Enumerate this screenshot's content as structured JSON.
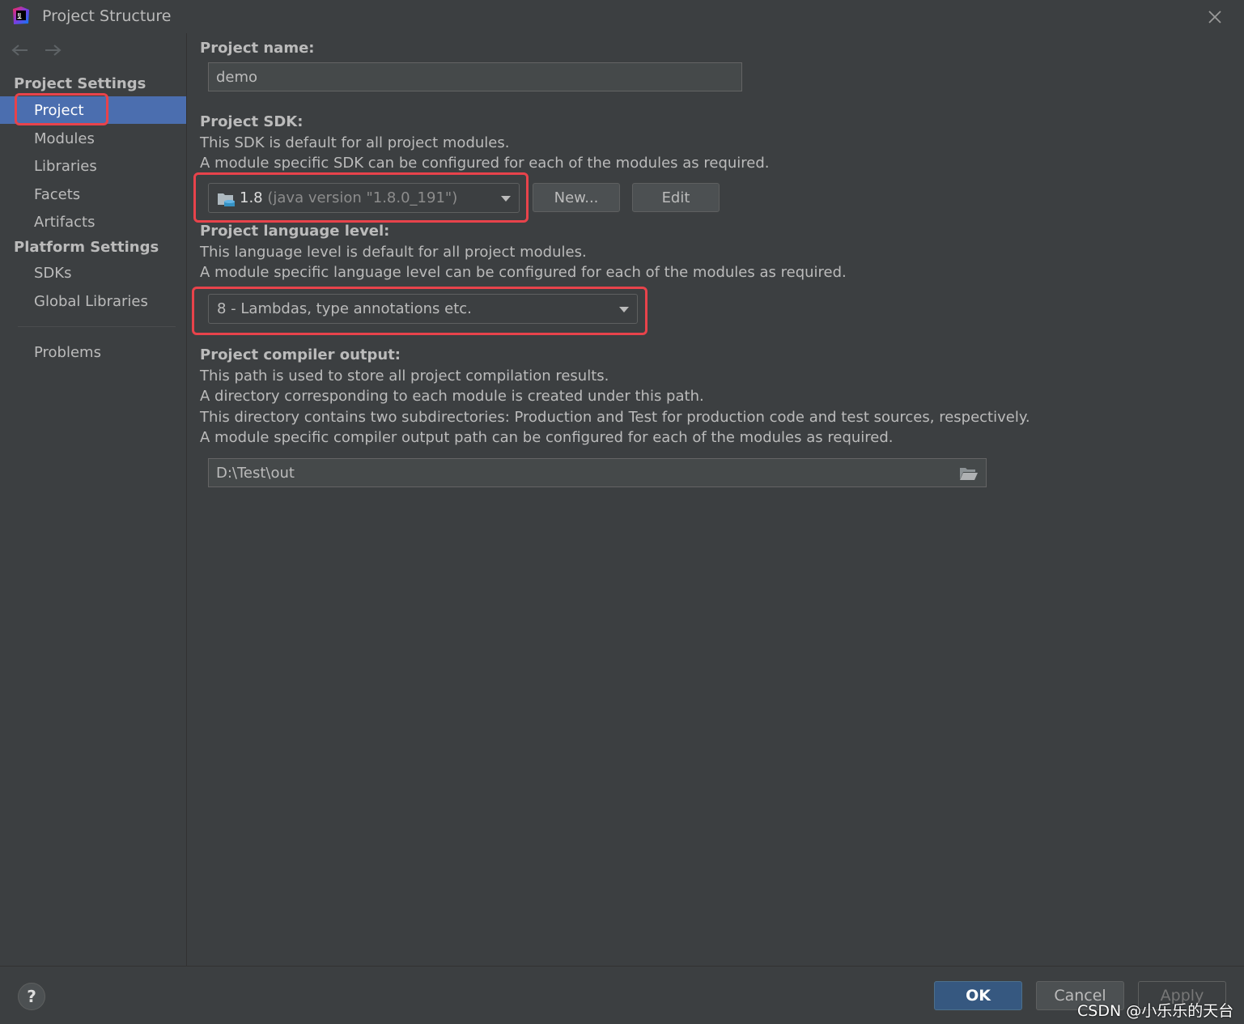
{
  "window": {
    "title": "Project Structure"
  },
  "sidebar": {
    "project_settings_header": "Project Settings",
    "project_settings_items": [
      {
        "label": "Project",
        "selected": true
      },
      {
        "label": "Modules"
      },
      {
        "label": "Libraries"
      },
      {
        "label": "Facets"
      },
      {
        "label": "Artifacts"
      }
    ],
    "platform_settings_header": "Platform Settings",
    "platform_settings_items": [
      {
        "label": "SDKs"
      },
      {
        "label": "Global Libraries"
      }
    ],
    "problems_label": "Problems"
  },
  "project_name": {
    "label": "Project name:",
    "value": "demo"
  },
  "project_sdk": {
    "label": "Project SDK:",
    "desc1": "This SDK is default for all project modules.",
    "desc2": "A module specific SDK can be configured for each of the modules as required.",
    "selected_version": "1.8",
    "selected_detail": "(java version \"1.8.0_191\")",
    "new_button": "New...",
    "edit_button": "Edit"
  },
  "language_level": {
    "label": "Project language level:",
    "desc1": "This language level is default for all project modules.",
    "desc2": "A module specific language level can be configured for each of the modules as required.",
    "selected": "8 - Lambdas, type annotations etc."
  },
  "compiler_output": {
    "label": "Project compiler output:",
    "desc1": "This path is used to store all project compilation results.",
    "desc2": "A directory corresponding to each module is created under this path.",
    "desc3": "This directory contains two subdirectories: Production and Test for production code and test sources, respectively.",
    "desc4": "A module specific compiler output path can be configured for each of the modules as required.",
    "path": "D:\\Test\\out"
  },
  "footer": {
    "help": "?",
    "ok": "OK",
    "cancel": "Cancel",
    "apply": "Apply",
    "watermark": "CSDN @小乐乐的天台"
  },
  "colors": {
    "background": "#3c3f41",
    "selection": "#4b6eaf",
    "highlight_frame": "#e8434b",
    "ok_button": "#365880"
  },
  "icons": {
    "app": "intellij-idea-icon",
    "close": "close-icon",
    "back": "arrow-left-icon",
    "forward": "arrow-right-icon",
    "sdk": "jdk-folder-icon",
    "browse": "folder-open-icon"
  }
}
